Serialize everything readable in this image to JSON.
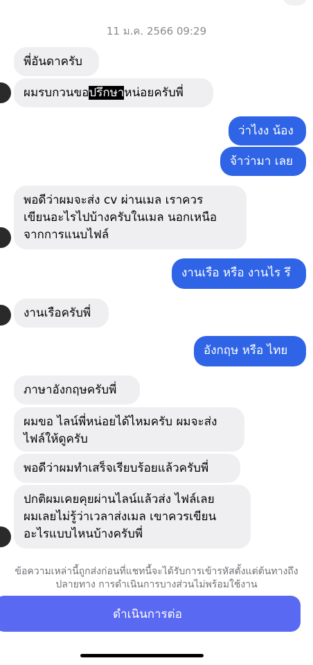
{
  "timestamp": "11 ม.ค. 2566 09:29",
  "messages": [
    {
      "side": "in",
      "text": "พี่อันดาครับ"
    },
    {
      "side": "in",
      "parts": [
        "ผมรบกวนขอ",
        "ปรึกษา",
        "หน่อยครับพี่"
      ]
    },
    {
      "side": "out",
      "text": "ว่าไงง น้อง"
    },
    {
      "side": "out",
      "text": "จ้าว่ามา เลย"
    },
    {
      "side": "in",
      "lines": [
        "พอดีว่าผมจะส่ง cv ผ่านเมล เราควร",
        "เขียนอะไรไปบ้างครับในเมล นอกเหนือ",
        "จากการแนบไฟล์"
      ]
    },
    {
      "side": "out",
      "text": "งานเรือ หรือ งานไร รึ"
    },
    {
      "side": "in",
      "text": "งานเรือครับพี่"
    },
    {
      "side": "out",
      "text": "อังกฤษ หรือ ไทย"
    },
    {
      "side": "in",
      "text": "ภาษาอังกฤษครับพี่"
    },
    {
      "side": "in",
      "lines": [
        "ผมขอ ไลน์พี่หน่อยได้ไหมครับ ผมจะส่ง",
        "ไฟล์ให้ดูครับ"
      ]
    },
    {
      "side": "in",
      "text": "พอดีว่าผมทำเสร็จเรียบร้อยแล้วครับพี่"
    },
    {
      "side": "in",
      "lines": [
        "ปกติผมเคยคุยผ่านไลน์แล้วส่ง ไฟล์เลย",
        "ผมเลยไม่รู้ว่าเวลาส่งเมล เขาควรเขียน",
        "อะไรแบบไหนบ้างครับพี่"
      ]
    }
  ],
  "notice": {
    "line1": "ข้อความเหล่านี้ถูกส่งก่อนที่แชทนี้จะได้รับการเข้ารหัสตั้งแต่ต้นทางถึง",
    "line2": "ปลายทาง การดำเนินการบางส่วนไม่พร้อมใช้งาน"
  },
  "continue_label": "ดำเนินการต่อ",
  "colors": {
    "outgoing_bubble": "#2f64e6",
    "incoming_bubble": "#efeff1",
    "continue_button": "#5a69f2"
  }
}
